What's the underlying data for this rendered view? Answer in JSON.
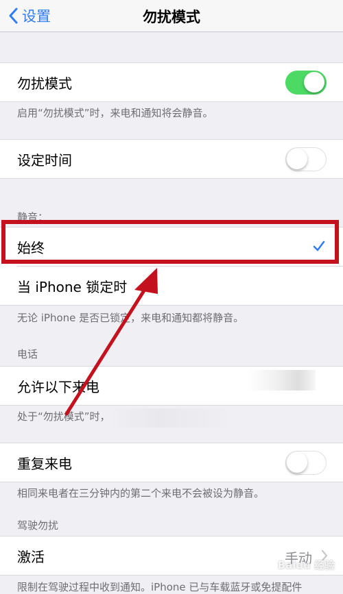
{
  "navbar": {
    "back_label": "设置",
    "title": "勿扰模式"
  },
  "dnd": {
    "label": "勿扰模式",
    "on": true,
    "note": "启用“勿扰模式”时，来电和通知将会静音。"
  },
  "scheduled": {
    "label": "设定时间",
    "on": false
  },
  "silence": {
    "header": "静音：",
    "options": [
      {
        "label": "始终",
        "selected": true
      },
      {
        "label": "当 iPhone 锁定时",
        "selected": false
      }
    ],
    "note": "无论 iPhone 是否已锁定，来电和通知都将静音。"
  },
  "phone": {
    "header": "电话",
    "allow_calls_label": "允许以下来电",
    "note": "处于“勿扰模式”时，",
    "repeated_label": "重复来电",
    "repeated_on": false,
    "repeated_note": "相同来电者在三分钟内的第二个来电不会被设为静音。"
  },
  "driving": {
    "header": "驾驶勿扰",
    "activate_label": "激活",
    "activate_value": "手动",
    "note": "限制在驾驶过程中收到通知。iPhone 已与车载蓝牙或免提配件"
  },
  "watermark": "Baidu 经验",
  "colors": {
    "accent": "#2f7cf6",
    "switch_on": "#4cd964",
    "annotation": "#c3111d"
  }
}
